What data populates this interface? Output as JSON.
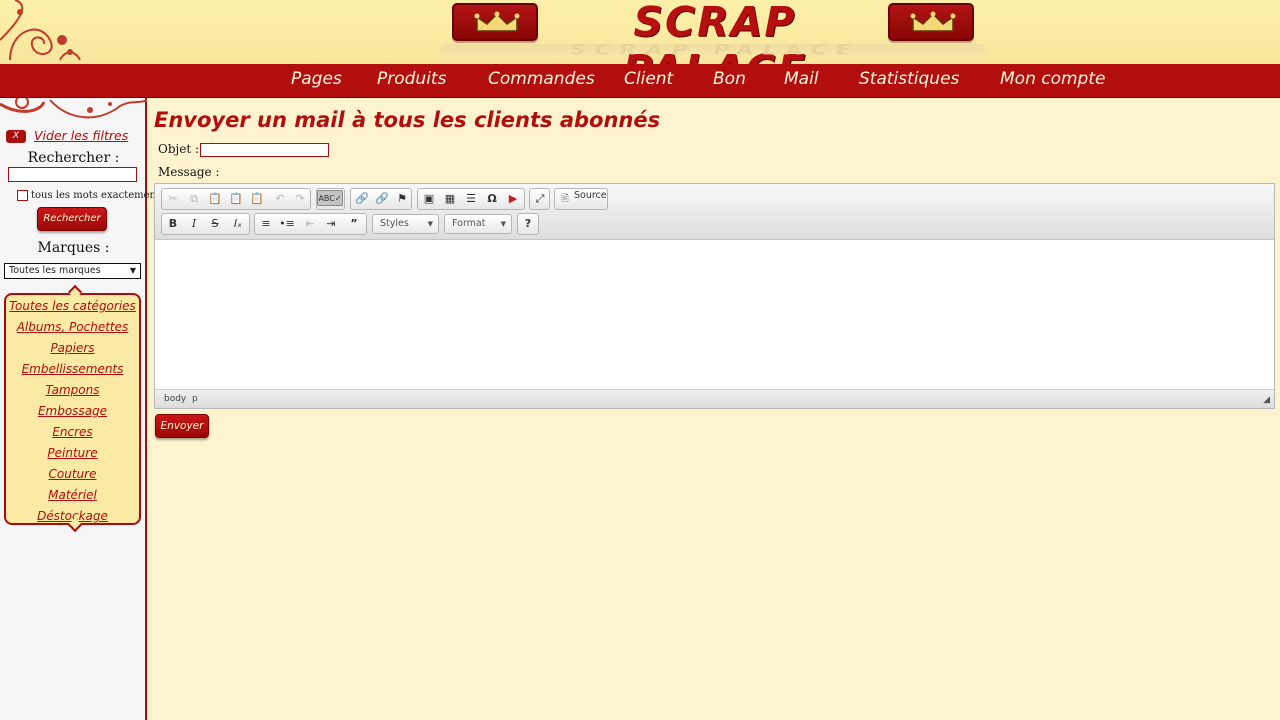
{
  "header": {
    "logo": "SCRAP PALACE",
    "logo_reflection": "SCRAP PALACE"
  },
  "nav": {
    "items": [
      "Pages",
      "Produits",
      "Commandes",
      "Client",
      "Bon",
      "Mail",
      "Statistiques",
      "Mon compte"
    ]
  },
  "sidebar": {
    "clear_filters": "Vider les filtres",
    "clear_badge": "X",
    "search_title": "Rechercher :",
    "search_value": "",
    "exact_label": "tous les mots exactement",
    "search_button": "Rechercher",
    "brands_title": "Marques :",
    "brands_selected": "Toutes les marques",
    "categories": [
      "Toutes les catégories",
      "Albums, Pochettes",
      "Papiers",
      "Embellissements",
      "Tampons",
      "Embossage",
      "Encres",
      "Peinture",
      "Couture",
      "Matériel",
      "Déstockage"
    ]
  },
  "main": {
    "title": "Envoyer un mail à tous les clients abonnés",
    "subject_label": "Objet :",
    "subject_value": "",
    "message_label": "Message :",
    "send_button": "Envoyer"
  },
  "editor": {
    "styles_label": "Styles",
    "format_label": "Format",
    "source_label": "Source",
    "help_label": "?",
    "path": [
      "body",
      "p"
    ]
  },
  "colors": {
    "brand_red": "#b20e0e",
    "page_background": "#fdf4cf",
    "category_panel": "#fbeaa6"
  }
}
